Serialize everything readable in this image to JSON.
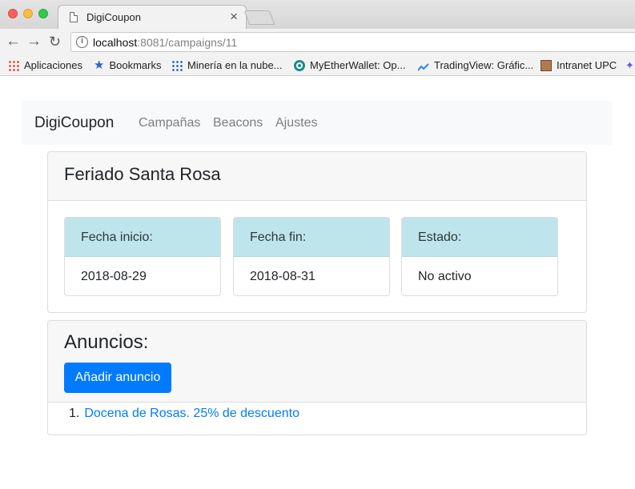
{
  "browser": {
    "tab_title": "DigiCoupon",
    "tab_close": "×",
    "url_host": "localhost",
    "url_rest": ":8081/campaigns/11",
    "bookmarks": [
      {
        "label": "Aplicaciones",
        "icon": "apps-grid-icon"
      },
      {
        "label": "Bookmarks",
        "icon": "star-icon"
      },
      {
        "label": "Minería en la nube...",
        "icon": "grid-favicon-icon"
      },
      {
        "label": "MyEtherWallet: Op...",
        "icon": "myetherwallet-icon"
      },
      {
        "label": "TradingView: Gráfic...",
        "icon": "tradingview-icon"
      },
      {
        "label": "Intranet UPC",
        "icon": "upc-favicon-icon"
      }
    ]
  },
  "navbar": {
    "brand": "DigiCoupon",
    "links": [
      "Campañas",
      "Beacons",
      "Ajustes"
    ]
  },
  "campaign": {
    "title": "Feriado Santa Rosa",
    "fields": [
      {
        "label": "Fecha inicio:",
        "value": "2018-08-29"
      },
      {
        "label": "Fecha fin:",
        "value": "2018-08-31"
      },
      {
        "label": "Estado:",
        "value": "No activo"
      }
    ]
  },
  "ads": {
    "title": "Anuncios:",
    "add_button": "Añadir anuncio",
    "items": [
      {
        "number": "1.",
        "label": "Docena de Rosas. 25% de descuento"
      }
    ]
  },
  "colors": {
    "primary": "#007bff",
    "info_header": "#bee5eb",
    "navbar_bg": "#f8f9fa"
  }
}
